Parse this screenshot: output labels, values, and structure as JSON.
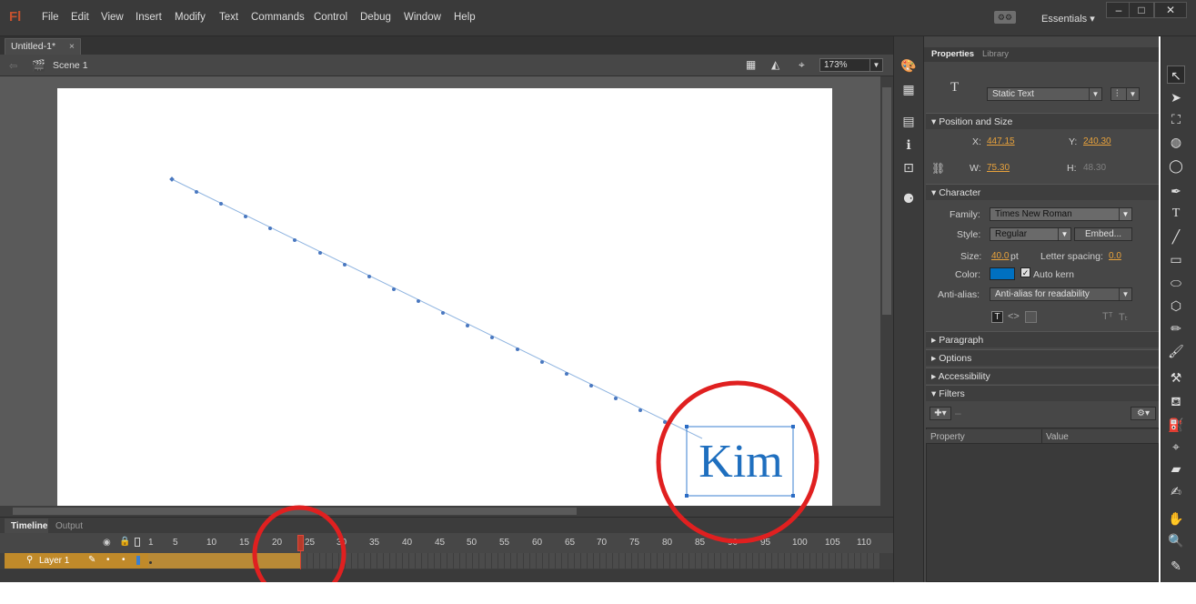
{
  "app": {
    "logo": "Fl"
  },
  "menu": [
    "File",
    "Edit",
    "View",
    "Insert",
    "Modify",
    "Text",
    "Commands",
    "Control",
    "Debug",
    "Window",
    "Help"
  ],
  "workspace": "Essentials",
  "window_controls": {
    "minimize": "–",
    "maximize": "□",
    "close": "✕"
  },
  "document": {
    "tab_title": "Untitled-1*",
    "tab_close": "×",
    "scene": "Scene 1",
    "zoom": "173%"
  },
  "stage_text": "Kim",
  "timeline": {
    "tabs": [
      "Timeline",
      "Output"
    ],
    "layer_name": "Layer 1",
    "frame_numbers": [
      "1",
      "5",
      "10",
      "15",
      "20",
      "25",
      "30",
      "35",
      "40",
      "45",
      "50",
      "55",
      "60",
      "65",
      "70",
      "75",
      "80",
      "85",
      "90",
      "95",
      "100",
      "105",
      "110"
    ],
    "current_frame": 24
  },
  "properties": {
    "tabs": [
      "Properties",
      "Library"
    ],
    "text_type": "Static Text",
    "sections": {
      "position_size": "Position and Size",
      "character": "Character",
      "paragraph": "Paragraph",
      "options": "Options",
      "accessibility": "Accessibility",
      "filters": "Filters"
    },
    "x_label": "X:",
    "x": "447.15",
    "y_label": "Y:",
    "y": "240.30",
    "w_label": "W:",
    "w": "75.30",
    "h_label": "H:",
    "h": "48.30",
    "family_label": "Family:",
    "family": "Times New Roman",
    "style_label": "Style:",
    "style": "Regular",
    "embed": "Embed...",
    "size_label": "Size:",
    "size": "40.0",
    "size_unit": "pt",
    "letter_spacing_label": "Letter spacing:",
    "letter_spacing": "0.0",
    "color_label": "Color:",
    "color": "#0070c0",
    "auto_kern": "Auto kern",
    "anti_alias_label": "Anti-alias:",
    "anti_alias": "Anti-alias for readability",
    "filter_columns": [
      "Property",
      "Value"
    ]
  }
}
